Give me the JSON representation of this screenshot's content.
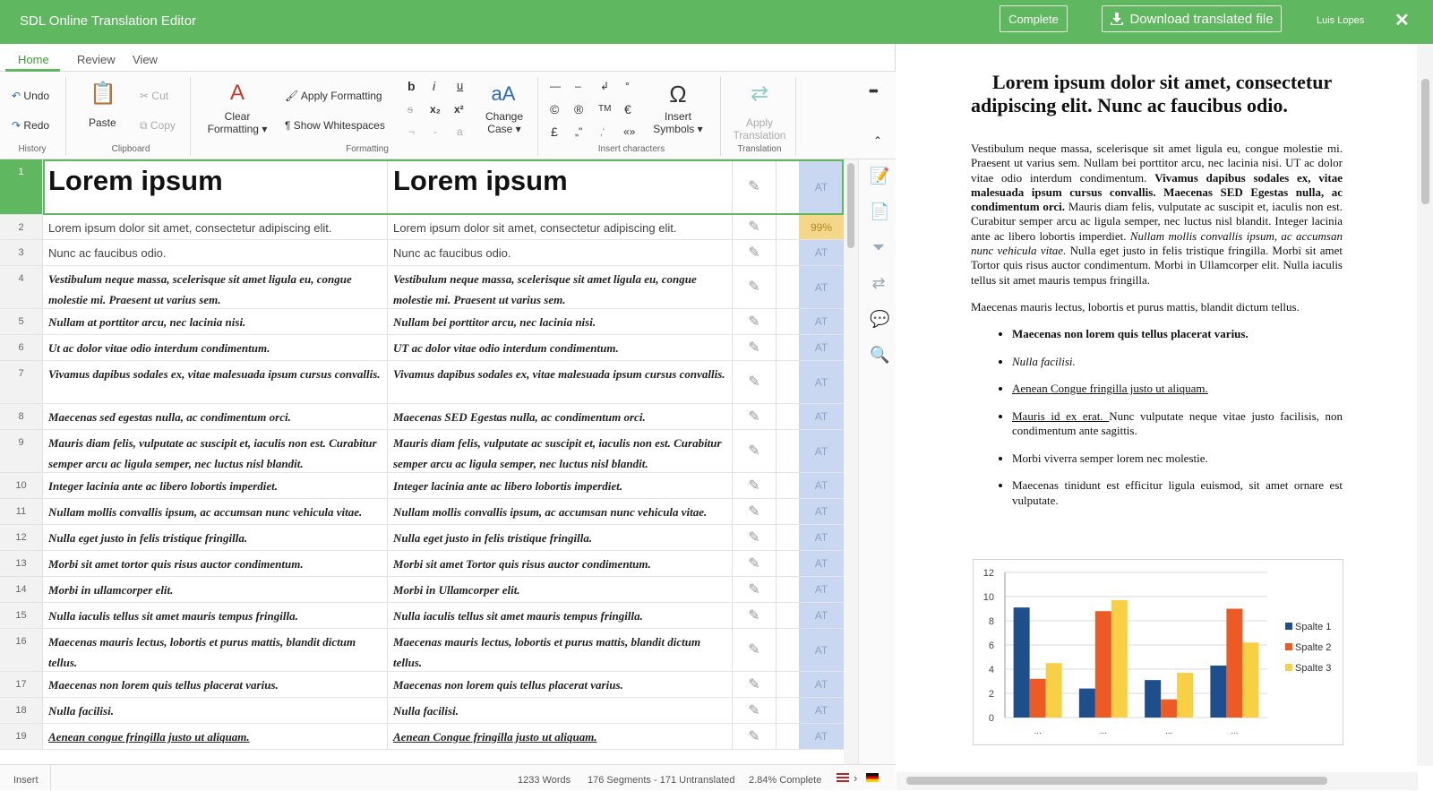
{
  "app": {
    "title": "SDL Online Translation Editor",
    "complete_label": "Complete",
    "download_label": "Download translated file",
    "user": "Luis Lopes",
    "close": "✕"
  },
  "tabs": [
    "Home",
    "Review",
    "View"
  ],
  "ribbon": {
    "undo": "Undo",
    "redo": "Redo",
    "history": "History",
    "paste": "Paste",
    "cut": "Cut",
    "copy": "Copy",
    "clipboard": "Clipboard",
    "clear_formatting_1": "Clear",
    "clear_formatting_2": "Formatting",
    "apply_formatting": "Apply Formatting",
    "show_whitespaces": "Show Whitespaces",
    "formatting": "Formatting",
    "change_case_1": "Change",
    "change_case_2": "Case",
    "insert_symbols_1": "Insert",
    "insert_symbols_2": "Symbols",
    "insert_characters": "Insert characters",
    "apply_translation_1": "Apply",
    "apply_translation_2": "Translation",
    "translation": "Translation",
    "more": "•••"
  },
  "segments": [
    {
      "n": "1",
      "src": "Lorem ipsum",
      "tgt": "Lorem ipsum",
      "status": "AT"
    },
    {
      "n": "2",
      "src": "Lorem ipsum dolor sit amet, consectetur adipiscing elit.",
      "tgt": "Lorem ipsum dolor sit amet, consectetur adipiscing elit.",
      "status": "99%"
    },
    {
      "n": "3",
      "src": "Nunc ac faucibus odio.",
      "tgt": "Nunc ac faucibus odio.",
      "status": "AT"
    },
    {
      "n": "4",
      "src": "Vestibulum neque massa, scelerisque sit amet ligula eu, congue molestie mi. Praesent ut varius sem.",
      "tgt": "Vestibulum neque massa, scelerisque sit amet ligula eu, congue molestie mi. Praesent ut varius sem.",
      "status": "AT"
    },
    {
      "n": "5",
      "src": "Nullam at porttitor arcu, nec lacinia nisi.",
      "tgt": "Nullam bei porttitor arcu, nec lacinia nisi.",
      "status": "AT"
    },
    {
      "n": "6",
      "src": "Ut ac dolor vitae odio interdum condimentum.",
      "tgt": "UT ac dolor vitae odio interdum condimentum.",
      "status": "AT"
    },
    {
      "n": "7",
      "src": "Vivamus dapibus sodales ex, vitae malesuada ipsum cursus convallis.",
      "tgt": "Vivamus dapibus sodales ex, vitae malesuada ipsum cursus convallis.",
      "status": "AT"
    },
    {
      "n": "8",
      "src": "Maecenas sed egestas nulla, ac condimentum orci.",
      "tgt": "Maecenas SED Egestas nulla, ac condimentum orci.",
      "status": "AT"
    },
    {
      "n": "9",
      "src": "Mauris diam felis, vulputate ac suscipit et, iaculis non est. Curabitur semper arcu ac ligula semper, nec luctus nisl blandit.",
      "tgt": "Mauris diam felis, vulputate ac suscipit et, iaculis non est. Curabitur semper arcu ac ligula semper, nec luctus nisl blandit.",
      "status": "AT"
    },
    {
      "n": "10",
      "src": "Integer lacinia ante ac libero lobortis imperdiet.",
      "tgt": "Integer lacinia ante ac libero lobortis imperdiet.",
      "status": "AT"
    },
    {
      "n": "11",
      "src": "Nullam mollis convallis ipsum, ac accumsan nunc vehicula vitae.",
      "tgt": "Nullam mollis convallis ipsum, ac accumsan nunc vehicula vitae.",
      "status": "AT"
    },
    {
      "n": "12",
      "src": "Nulla eget justo in felis tristique fringilla.",
      "tgt": "Nulla eget justo in felis tristique fringilla.",
      "status": "AT"
    },
    {
      "n": "13",
      "src": "Morbi sit amet tortor quis risus auctor condimentum.",
      "tgt": "Morbi sit amet Tortor quis risus auctor condimentum.",
      "status": "AT"
    },
    {
      "n": "14",
      "src": "Morbi in ullamcorper elit.",
      "tgt": "Morbi in Ullamcorper elit.",
      "status": "AT"
    },
    {
      "n": "15",
      "src": "Nulla iaculis tellus sit amet mauris tempus fringilla.",
      "tgt": "Nulla iaculis tellus sit amet mauris tempus fringilla.",
      "status": "AT"
    },
    {
      "n": "16",
      "src": "Maecenas mauris lectus, lobortis et purus mattis, blandit dictum tellus.",
      "tgt": "Maecenas mauris lectus, lobortis et purus mattis, blandit dictum tellus.",
      "status": "AT"
    },
    {
      "n": "17",
      "src": "Maecenas non lorem quis tellus placerat varius.",
      "tgt": "Maecenas non lorem quis tellus placerat varius.",
      "status": "AT"
    },
    {
      "n": "18",
      "src": "Nulla facilisi.",
      "tgt": "Nulla facilisi.",
      "status": "AT"
    },
    {
      "n": "19",
      "src": "Aenean congue fringilla justo ut aliquam.",
      "tgt": "Aenean Congue fringilla justo ut aliquam.",
      "status": "AT"
    }
  ],
  "status_bar": {
    "mode": "Insert",
    "words": "1233 Words",
    "segments": "176 Segments - 171 Untranslated",
    "complete": "2.84% Complete"
  },
  "doc": {
    "title": "Lorem ipsum dolor sit amet, consectetur adipiscing elit. Nunc ac faucibus odio.",
    "p1_a": "Vestibulum neque massa, scelerisque sit amet ligula eu, congue molestie mi. Praesent ut varius sem. Nullam bei porttitor arcu, nec lacinia nisi. UT ac dolor vitae odio interdum condimentum. ",
    "p1_b": "Vivamus dapibus sodales ex, vitae malesuada ipsum cursus convallis. Maecenas SED Egestas nulla, ac condimentum orci.",
    "p1_c": " Mauris diam felis, vulputate ac suscipit et, iaculis non est. Curabitur semper arcu ac ligula semper, nec luctus nisl blandit. Integer lacinia ante ac libero lobortis imperdiet. ",
    "p1_d": "Nullam mollis convallis ipsum, ac accumsan nunc vehicula vitae.",
    "p1_e": " Nulla eget justo in felis tristique fringilla. Morbi sit amet Tortor quis risus auctor condimentum. Morbi in Ullamcorper elit. Nulla iaculis tellus sit amet mauris tempus fringilla.",
    "p2": "Maecenas mauris lectus, lobortis et purus mattis, blandit dictum tellus.",
    "li1": "Maecenas non lorem quis tellus placerat varius.",
    "li2": "Nulla facilisi.",
    "li3": "Aenean Congue fringilla justo ut aliquam.",
    "li4_a": "Mauris id ex erat. ",
    "li4_b": "Nunc vulputate neque vitae justo facilisis, non condimentum ante sagittis.",
    "li5": "Morbi viverra semper lorem nec molestie.",
    "li6": "Maecenas tinidunt est efficitur ligula euismod, sit amet ornare est vulputate."
  },
  "chart_data": {
    "type": "bar",
    "categories": [
      "...",
      "...",
      "...",
      "..."
    ],
    "series": [
      {
        "name": "Spalte 1",
        "values": [
          9.1,
          2.4,
          3.1,
          4.3
        ],
        "color": "#1f4e8c"
      },
      {
        "name": "Spalte 2",
        "values": [
          3.2,
          8.8,
          1.5,
          9.0
        ],
        "color": "#ee5a24"
      },
      {
        "name": "Spalte 3",
        "values": [
          4.5,
          9.7,
          3.7,
          6.2
        ],
        "color": "#f7d046"
      }
    ],
    "ylim": [
      0,
      12
    ],
    "yticks": [
      "0",
      "2",
      "4",
      "6",
      "8",
      "10",
      "12"
    ],
    "grid": true,
    "legend": "right"
  },
  "colors": {
    "accent": "#5fb85f",
    "at_badge": "#c9d7f0",
    "match_badge": "#f5d78a"
  }
}
